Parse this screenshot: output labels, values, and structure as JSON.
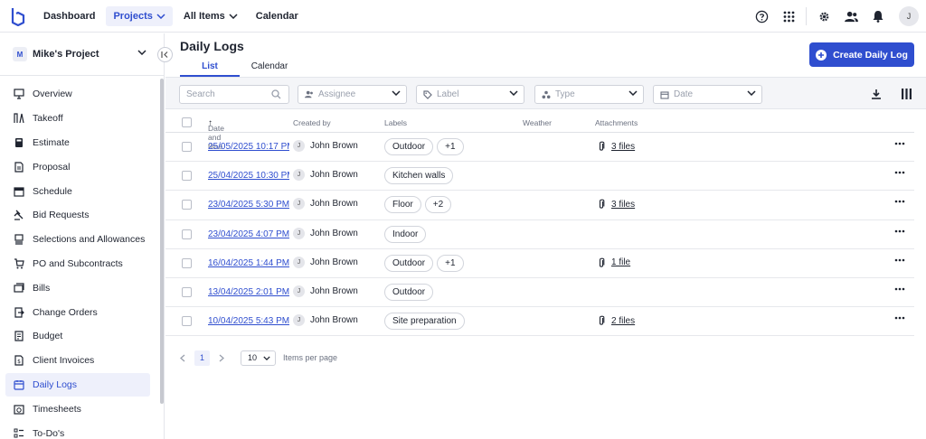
{
  "nav": {
    "dashboard": "Dashboard",
    "projects": "Projects",
    "all_items": "All Items",
    "calendar": "Calendar",
    "avatar_initial": "J"
  },
  "sidebar": {
    "project_initial": "M",
    "project_name": "Mike's Project",
    "items": [
      {
        "label": "Overview",
        "icon": "presentation-icon"
      },
      {
        "label": "Takeoff",
        "icon": "measure-icon"
      },
      {
        "label": "Estimate",
        "icon": "calculator-icon"
      },
      {
        "label": "Proposal",
        "icon": "document-icon"
      },
      {
        "label": "Schedule",
        "icon": "calendar-icon"
      },
      {
        "label": "Bid Requests",
        "icon": "gavel-icon"
      },
      {
        "label": "Selections and Allowances",
        "icon": "stack-icon"
      },
      {
        "label": "PO and Subcontracts",
        "icon": "cart-icon"
      },
      {
        "label": "Bills",
        "icon": "bills-icon"
      },
      {
        "label": "Change Orders",
        "icon": "change-icon"
      },
      {
        "label": "Budget",
        "icon": "budget-icon"
      },
      {
        "label": "Client Invoices",
        "icon": "invoice-icon"
      },
      {
        "label": "Daily Logs",
        "icon": "daily-log-icon",
        "active": true
      },
      {
        "label": "Timesheets",
        "icon": "timesheet-icon"
      },
      {
        "label": "To-Do's",
        "icon": "todo-icon"
      }
    ]
  },
  "page": {
    "title": "Daily Logs",
    "tabs": [
      "List",
      "Calendar"
    ],
    "create_label": "Create Daily Log"
  },
  "filters": {
    "search_placeholder": "Search",
    "assignee": "Assignee",
    "label": "Label",
    "type": "Type",
    "date": "Date"
  },
  "table": {
    "columns": {
      "date": "Date and time",
      "created_by": "Created by",
      "labels": "Labels",
      "weather": "Weather",
      "attachments": "Attachments"
    },
    "rows": [
      {
        "date": "25/05/2025 10:17 PM",
        "creator": "John Brown",
        "initial": "J",
        "labels": [
          "Outdoor",
          "+1"
        ],
        "attachments": "3 files"
      },
      {
        "date": "25/04/2025 10:30 PM",
        "creator": "John Brown",
        "initial": "J",
        "labels": [
          "Kitchen walls"
        ],
        "attachments": ""
      },
      {
        "date": "23/04/2025 5:30 PM",
        "creator": "John Brown",
        "initial": "J",
        "labels": [
          "Floor",
          "+2"
        ],
        "attachments": "3 files"
      },
      {
        "date": "23/04/2025 4:07 PM",
        "creator": "John Brown",
        "initial": "J",
        "labels": [
          "Indoor"
        ],
        "attachments": ""
      },
      {
        "date": "16/04/2025 1:44 PM",
        "creator": "John Brown",
        "initial": "J",
        "labels": [
          "Outdoor",
          "+1"
        ],
        "attachments": "1 file"
      },
      {
        "date": "13/04/2025 2:01 PM",
        "creator": "John Brown",
        "initial": "J",
        "labels": [
          "Outdoor"
        ],
        "attachments": ""
      },
      {
        "date": "10/04/2025 5:43 PM",
        "creator": "John Brown",
        "initial": "J",
        "labels": [
          "Site preparation"
        ],
        "attachments": "2 files"
      }
    ]
  },
  "pagination": {
    "current_page": "1",
    "per_page": "10",
    "per_page_label": "Items per page"
  },
  "colors": {
    "accent": "#2f4ecf",
    "active_bg": "#eef0fb"
  }
}
